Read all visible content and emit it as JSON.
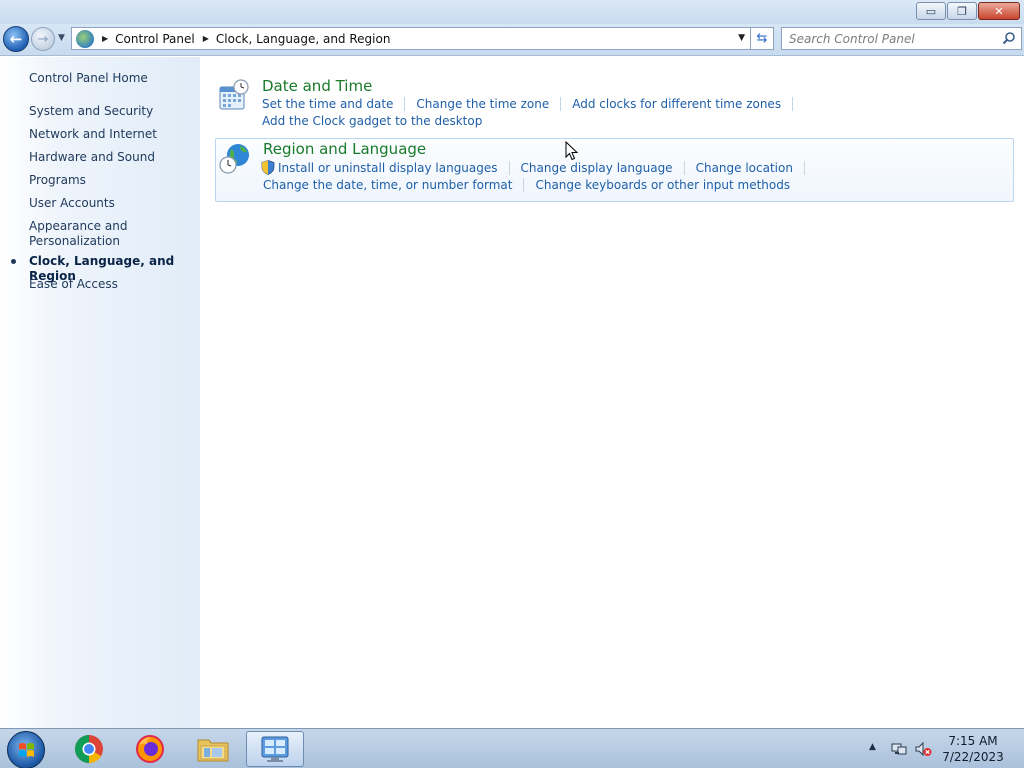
{
  "window": {
    "minimize_glyph": "▭",
    "restore_glyph": "❐",
    "close_glyph": "✕"
  },
  "nav": {
    "back_glyph": "←",
    "forward_glyph": "→",
    "history_dropdown_glyph": "▼",
    "breadcrumbs": [
      "Control Panel",
      "Clock, Language, and Region"
    ],
    "crumb_separator": "▶",
    "address_dropdown_glyph": "▼",
    "refresh_glyph": "⇆",
    "search_placeholder": "Search Control Panel"
  },
  "sidebar": {
    "home": "Control Panel Home",
    "items": [
      "System and Security",
      "Network and Internet",
      "Hardware and Sound",
      "Programs",
      "User Accounts",
      "Appearance and Personalization",
      "Clock, Language, and Region",
      "Ease of Access"
    ],
    "current": "Clock, Language, and Region"
  },
  "categories": [
    {
      "title": "Date and Time",
      "icon": "calendar-clock-icon",
      "links_row1": [
        "Set the time and date",
        "Change the time zone",
        "Add clocks for different time zones"
      ],
      "links_row2": [
        "Add the Clock gadget to the desktop"
      ]
    },
    {
      "title": "Region and Language",
      "icon": "globe-clock-icon",
      "links_row1": [
        "Install or uninstall display languages",
        "Change display language",
        "Change location"
      ],
      "links_row2": [
        "Change the date, time, or number format",
        "Change keyboards or other input methods"
      ]
    }
  ],
  "taskbar": {
    "apps": [
      "chrome-icon",
      "firefox-icon",
      "file-explorer-icon",
      "control-panel-icon"
    ],
    "active_app": "control-panel-icon",
    "tray_expand_glyph": "▲",
    "time": "7:15 AM",
    "date": "7/22/2023"
  },
  "colors": {
    "link": "#1f5fa8",
    "category_title": "#1a7a2a",
    "sidebar_text": "#1e395b"
  }
}
